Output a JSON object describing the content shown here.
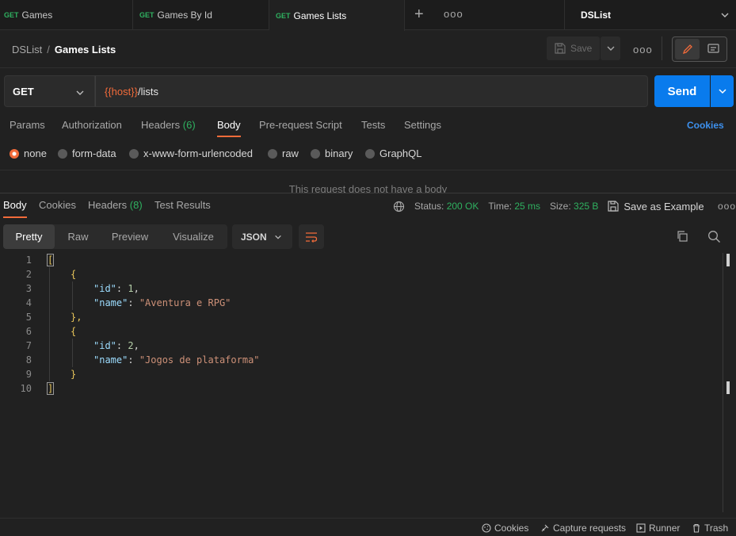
{
  "tabs": [
    {
      "method": "GET",
      "label": "Games"
    },
    {
      "method": "GET",
      "label": "Games By Id"
    },
    {
      "method": "GET",
      "label": "Games Lists"
    }
  ],
  "tabs_more": "ooo",
  "environment": "DSList",
  "breadcrumb": {
    "workspace": "DSList",
    "separator": "/",
    "current": "Games Lists"
  },
  "header": {
    "save_label": "Save",
    "more": "ooo"
  },
  "request": {
    "method": "GET",
    "url_var": "{{host}}",
    "url_path": "/lists",
    "send_label": "Send"
  },
  "request_tabs": {
    "params": "Params",
    "authorization": "Authorization",
    "headers": "Headers",
    "headers_count": "(6)",
    "body": "Body",
    "prerequest": "Pre-request Script",
    "tests": "Tests",
    "settings": "Settings",
    "cookies": "Cookies"
  },
  "body_types": {
    "none": "none",
    "form_data": "form-data",
    "urlencoded": "x-www-form-urlencoded",
    "raw": "raw",
    "binary": "binary",
    "graphql": "GraphQL"
  },
  "no_body_text": "This request does not have a body",
  "response_tabs": {
    "body": "Body",
    "cookies": "Cookies",
    "headers": "Headers",
    "headers_count": "(8)",
    "test_results": "Test Results"
  },
  "response_meta": {
    "status_label": "Status:",
    "status_value": "200 OK",
    "time_label": "Time:",
    "time_value": "25 ms",
    "size_label": "Size:",
    "size_value": "325 B",
    "save_example": "Save as Example",
    "more": "ooo"
  },
  "format_tabs": {
    "pretty": "Pretty",
    "raw": "Raw",
    "preview": "Preview",
    "visualize": "Visualize",
    "format": "JSON"
  },
  "response_body": {
    "line_numbers": [
      "1",
      "2",
      "3",
      "4",
      "5",
      "6",
      "7",
      "8",
      "9",
      "10"
    ],
    "open_array": "[",
    "close_array": "]",
    "open_obj": "{",
    "close_obj": "}",
    "obj_sep": "},",
    "key_id": "\"id\"",
    "key_name": "\"name\"",
    "colon": ": ",
    "comma": ",",
    "items": [
      {
        "id": "1",
        "name": "\"Aventura e RPG\""
      },
      {
        "id": "2",
        "name": "\"Jogos de plataforma\""
      }
    ]
  },
  "statusbar": {
    "cookies": "Cookies",
    "capture": "Capture requests",
    "runner": "Runner",
    "trash": "Trash"
  }
}
